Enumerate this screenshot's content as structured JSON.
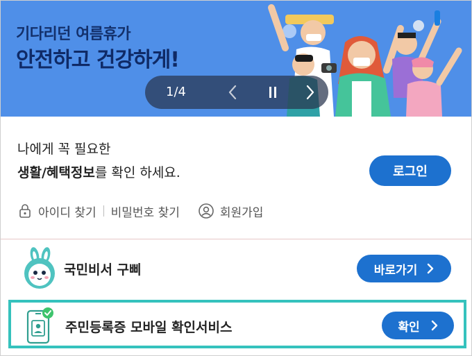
{
  "banner": {
    "subtitle": "기다리던 여름휴가",
    "title": "안전하고 건강하게!",
    "pager": {
      "current": "1/4"
    }
  },
  "login": {
    "message_line1": "나에게 꼭 필요한",
    "message_bold": "생활/혜택정보",
    "message_rest": "를 확인 하세요.",
    "button": "로그인"
  },
  "account_links": [
    {
      "label": "아이디 찾기",
      "icon": "lock-icon"
    },
    {
      "label": "비밀번호 찾기",
      "icon": ""
    },
    {
      "label": "회원가입",
      "icon": "user-icon"
    }
  ],
  "services": {
    "secretary": {
      "label": "국민비서 구삐",
      "button": "바로가기",
      "icon": "rabbit-mascot-icon"
    },
    "id_card": {
      "label": "주민등록증 모바일 확인서비스",
      "button": "확인",
      "icon": "mobile-id-check-icon"
    }
  },
  "colors": {
    "accent": "#1d71cf",
    "banner_bg": "#4f8fe8",
    "highlight_border": "#35c2bd"
  }
}
